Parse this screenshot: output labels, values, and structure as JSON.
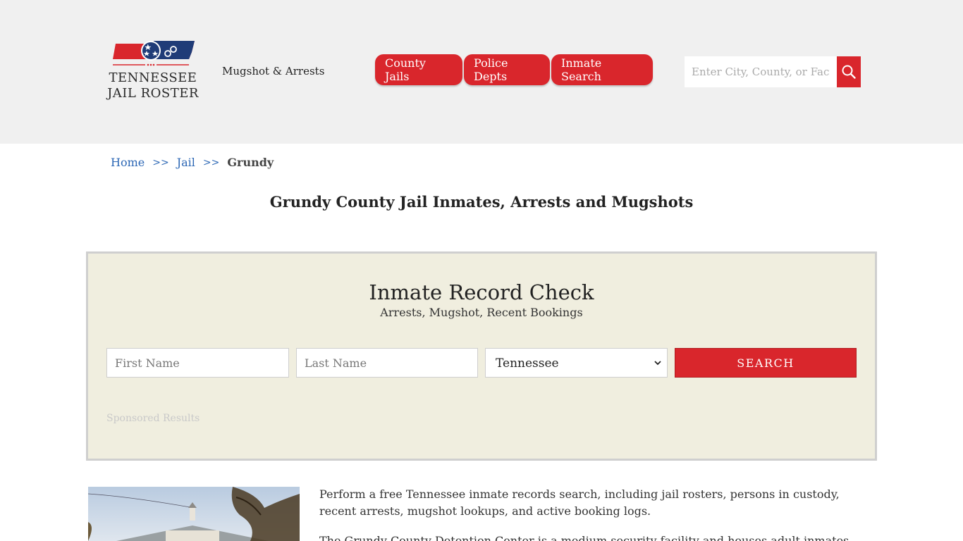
{
  "header": {
    "logo_line1": "TENNESSEE",
    "logo_line2": "JAIL ROSTER",
    "tagline": "Mugshot & Arrests",
    "nav": [
      "County Jails",
      "Police Depts",
      "Inmate Search"
    ],
    "search_placeholder": "Enter City, County, or Facility"
  },
  "breadcrumb": {
    "home": "Home",
    "sep": ">>",
    "jail": "Jail",
    "current": "Grundy"
  },
  "page_title": "Grundy County Jail Inmates, Arrests and Mugshots",
  "record_check": {
    "title": "Inmate Record Check",
    "subtitle": "Arrests, Mugshot, Recent Bookings",
    "first_placeholder": "First Name",
    "last_placeholder": "Last Name",
    "state_value": "Tennessee",
    "search_label": "SEARCH",
    "sponsored": "Sponsored Results"
  },
  "intro": "Perform a free Tennessee inmate records search, including jail rosters, persons in custody, recent arrests, mugshot lookups, and active booking logs.",
  "intro2": "The Grundy County Detention Center is a medium security facility and houses adult inmates and",
  "colors": {
    "accent": "#d9262c",
    "link": "#2c67b5",
    "panel_bg": "#f0eedf",
    "header_bg": "#f0f0f0"
  }
}
